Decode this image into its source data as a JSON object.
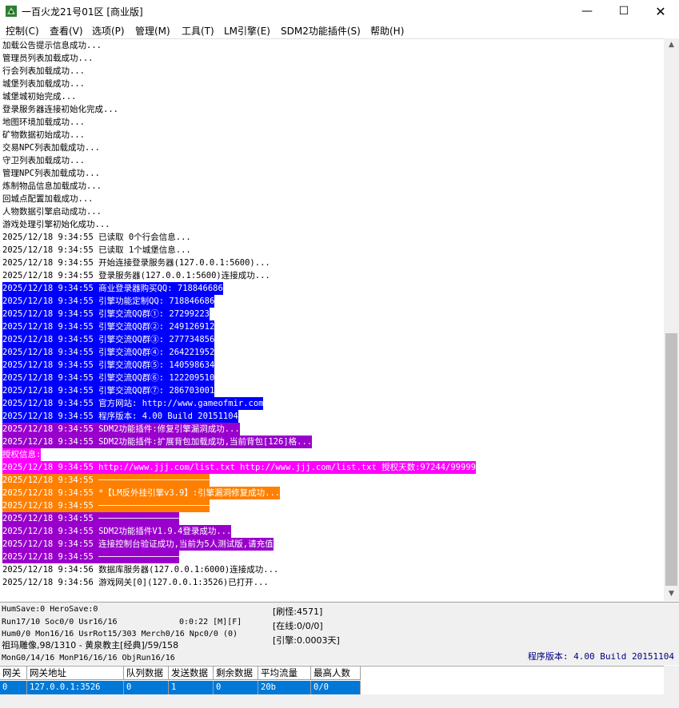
{
  "window": {
    "title": "一百火龙21号01区 [商业版]",
    "minimize": "—",
    "maximize": "☐",
    "close": "✕"
  },
  "menu": [
    {
      "label": "控制(C)"
    },
    {
      "label": "查看(V)"
    },
    {
      "label": "选项(P)"
    },
    {
      "label": "管理(M)"
    },
    {
      "label": "工具(T)"
    },
    {
      "label": "LM引擎(E)"
    },
    {
      "label": "SDM2功能插件(S)"
    },
    {
      "label": "帮助(H)"
    }
  ],
  "log": [
    {
      "text": "加载公告提示信息成功...",
      "style": ""
    },
    {
      "text": "管理员列表加载成功...",
      "style": ""
    },
    {
      "text": "行会列表加载成功...",
      "style": ""
    },
    {
      "text": "城堡列表加载成功...",
      "style": ""
    },
    {
      "text": "城堡城初始完成...",
      "style": ""
    },
    {
      "text": "登录服务器连接初始化完成...",
      "style": ""
    },
    {
      "text": "地图环境加载成功...",
      "style": ""
    },
    {
      "text": "矿物数据初始成功...",
      "style": ""
    },
    {
      "text": "交易NPC列表加载成功...",
      "style": ""
    },
    {
      "text": "守卫列表加载成功...",
      "style": ""
    },
    {
      "text": "管理NPC列表加载成功...",
      "style": ""
    },
    {
      "text": "炼制物品信息加载成功...",
      "style": ""
    },
    {
      "text": "回城点配置加载成功...",
      "style": ""
    },
    {
      "text": "人物数据引擎启动成功...",
      "style": ""
    },
    {
      "text": "游戏处理引擎初始化成功...",
      "style": ""
    },
    {
      "text": "2025/12/18 9:34:55 已读取 0个行会信息...",
      "style": ""
    },
    {
      "text": "2025/12/18 9:34:55 已读取 1个城堡信息...",
      "style": ""
    },
    {
      "text": "2025/12/18 9:34:55 开始连接登录服务器(127.0.0.1:5600)...",
      "style": ""
    },
    {
      "text": "2025/12/18 9:34:55 登录服务器(127.0.0.1:5600)连接成功...",
      "style": ""
    },
    {
      "text": "2025/12/18 9:34:55 商业登录器购买QQ: 718846686",
      "style": "blue"
    },
    {
      "text": "2025/12/18 9:34:55 引擎功能定制QQ: 718846686",
      "style": "blue"
    },
    {
      "text": "2025/12/18 9:34:55 引擎交流QQ群①: 27299223",
      "style": "blue"
    },
    {
      "text": "2025/12/18 9:34:55 引擎交流QQ群②: 249126912",
      "style": "blue"
    },
    {
      "text": "2025/12/18 9:34:55 引擎交流QQ群③: 277734856",
      "style": "blue"
    },
    {
      "text": "2025/12/18 9:34:55 引擎交流QQ群④: 264221952",
      "style": "blue"
    },
    {
      "text": "2025/12/18 9:34:55 引擎交流QQ群⑤: 140598634",
      "style": "blue"
    },
    {
      "text": "2025/12/18 9:34:55 引擎交流QQ群⑥: 122209510",
      "style": "blue"
    },
    {
      "text": "2025/12/18 9:34:55 引擎交流QQ群⑦: 286703001",
      "style": "blue"
    },
    {
      "text": "2025/12/18 9:34:55 官方网站: http://www.gameofmir.com",
      "style": "blue"
    },
    {
      "text": "2025/12/18 9:34:55 程序版本: 4.00 Build 20151104",
      "style": "blue"
    },
    {
      "text": "2025/12/18 9:34:55 SDM2功能插件:修复引擎漏洞成功...",
      "style": "purple"
    },
    {
      "text": "2025/12/18 9:34:55 SDM2功能插件:扩展背包加载成功,当前背包[126]格...",
      "style": "purple"
    },
    {
      "text": "授权信息:",
      "style": "magenta"
    },
    {
      "text": "2025/12/18 9:34:55 http://www.jjj.com/list.txt http://www.jjj.com/list.txt 授权天数:97244/99999",
      "style": "magenta"
    },
    {
      "text": "2025/12/18 9:34:55 ──────────────────────",
      "style": "orange"
    },
    {
      "text": "2025/12/18 9:34:55 *【LM反外挂引擎v3.9】:引擎漏洞修复成功...",
      "style": "orange"
    },
    {
      "text": "2025/12/18 9:34:55 ──────────────────────",
      "style": "orange"
    },
    {
      "text": "2025/12/18 9:34:55 ────────────────",
      "style": "purple"
    },
    {
      "text": "2025/12/18 9:34:55 SDM2功能插件V1.9.4登录成功...",
      "style": "purple"
    },
    {
      "text": "2025/12/18 9:34:55 连接控制台验证成功,当前为5人测试版,请充值",
      "style": "purple"
    },
    {
      "text": "2025/12/18 9:34:55 ────────────────",
      "style": "purple"
    },
    {
      "text": "2025/12/18 9:34:56 数据库服务器(127.0.0.1:6000)连接成功...",
      "style": ""
    },
    {
      "text": "2025/12/18 9:34:56 游戏网关[0](127.0.0.1:3526)已打开...",
      "style": ""
    }
  ],
  "scrollbar": {
    "up": "▲",
    "down": "▼"
  },
  "status": {
    "hum_save": "HumSave:0 HeroSave:0",
    "run_line": "Run17/10 Soc0/0 Usr16/16",
    "timer": "0:0:22 [M][F]",
    "hum_line": "Hum0/0 Mon16/16 UsrRot15/303 Merch0/16 Npc0/0 (0)",
    "map_line": "祖玛雕像,98/1310 - 黄泉教主[经典]/59/158",
    "mon_line": "MonG0/14/16 MonP16/16/16 ObjRun16/16",
    "refresh_monster": "[刷怪:4571]",
    "online": "[在线:0/0/0]",
    "engine": "[引擎:0.0003天]",
    "version": "程序版本: 4.00 Build 20151104"
  },
  "gateway_table": {
    "columns": [
      "网关",
      "网关地址",
      "队列数据",
      "发送数据",
      "剩余数据",
      "平均流量",
      "最高人数"
    ],
    "rows": [
      [
        "0",
        "127.0.0.1:3526",
        "0",
        "1",
        "0",
        "20b",
        "0/0"
      ]
    ]
  },
  "colors": {
    "blue": "#0000ff",
    "purple": "#9900cc",
    "magenta": "#ff00ff",
    "orange": "#ff8000",
    "selection": "#0078d7"
  }
}
